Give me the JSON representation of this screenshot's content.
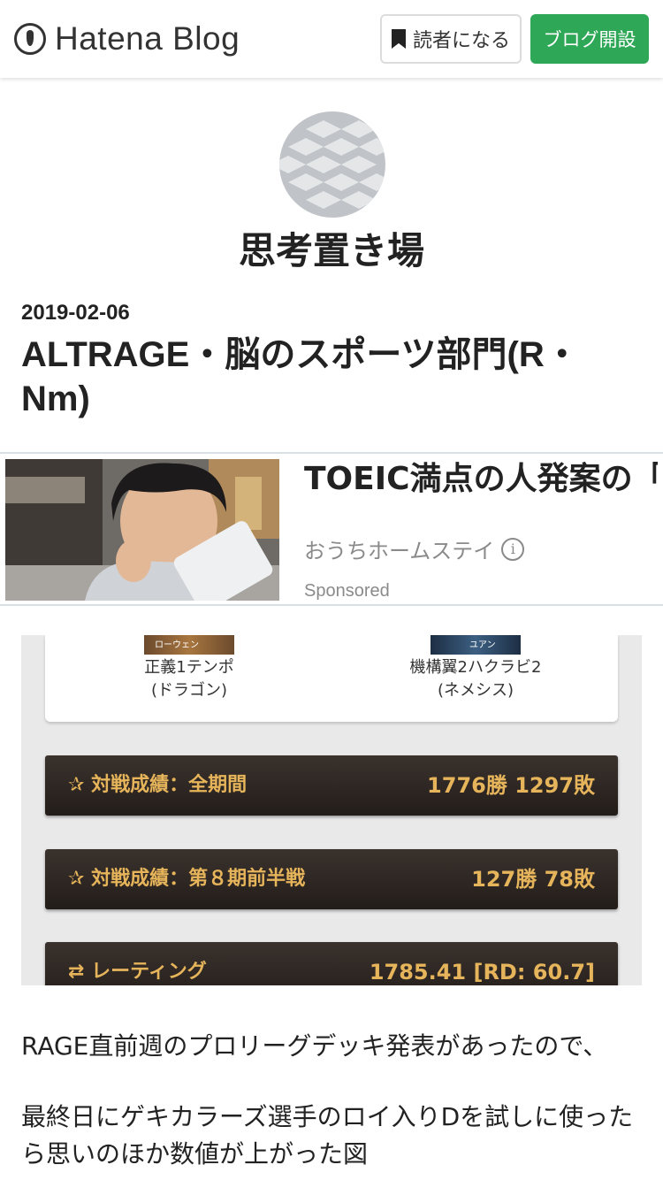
{
  "header": {
    "logo_text": "Hatena Blog",
    "subscribe_label": "読者になる",
    "open_blog_label": "ブログ開設"
  },
  "blog": {
    "title": "思考置き場"
  },
  "post": {
    "date": "2019-02-06",
    "title": "ALTRAGE・脳のスポーツ部門(R・Nm)"
  },
  "ad": {
    "headline": "TOEIC満点の人発案の「スマホゲーム英会",
    "advertiser": "おうちホームステイ",
    "sponsored_label": "Sponsored"
  },
  "screenshot": {
    "decks": [
      {
        "thumb_label": "ローウェン",
        "name_line1": "正義1テンポ",
        "name_line2": "(ドラゴン)"
      },
      {
        "thumb_label": "ユアン",
        "name_line1": "機構翼2ハクラビ2",
        "name_line2": "(ネメシス)"
      }
    ],
    "stats": [
      {
        "label": "対戦成績：全期間",
        "value": "1776勝 1297敗"
      },
      {
        "label": "対戦成績：第８期前半戦",
        "value": "127勝 78敗"
      },
      {
        "label": "レーティング",
        "value": "1785.41 [RD: 60.7]"
      }
    ]
  },
  "body": {
    "paragraphs": [
      "RAGE直前週のプロリーグデッキ発表があったので、",
      "最終日にゲキカラーズ選手のロイ入りDを試しに使ったら思いのほか数値が上がった図"
    ]
  },
  "colors": {
    "accent_green": "#2ea756",
    "stat_text_gold": "#e6b45a",
    "stat_bar_dark": "#2b2420"
  }
}
